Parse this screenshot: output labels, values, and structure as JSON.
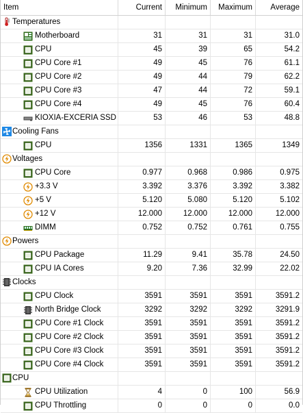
{
  "columns": [
    "Item",
    "Current",
    "Minimum",
    "Maximum",
    "Average"
  ],
  "groups": [
    {
      "label": "Temperatures",
      "icon": "thermometer-icon",
      "items": [
        {
          "label": "Motherboard",
          "icon": "motherboard-icon",
          "current": "31",
          "minimum": "31",
          "maximum": "31",
          "average": "31.0"
        },
        {
          "label": "CPU",
          "icon": "cpu-chip-icon",
          "current": "45",
          "minimum": "39",
          "maximum": "65",
          "average": "54.2"
        },
        {
          "label": "CPU Core #1",
          "icon": "cpu-chip-icon",
          "current": "49",
          "minimum": "45",
          "maximum": "76",
          "average": "61.1"
        },
        {
          "label": "CPU Core #2",
          "icon": "cpu-chip-icon",
          "current": "49",
          "minimum": "44",
          "maximum": "79",
          "average": "62.2"
        },
        {
          "label": "CPU Core #3",
          "icon": "cpu-chip-icon",
          "current": "47",
          "minimum": "44",
          "maximum": "72",
          "average": "59.1"
        },
        {
          "label": "CPU Core #4",
          "icon": "cpu-chip-icon",
          "current": "49",
          "minimum": "45",
          "maximum": "76",
          "average": "60.4"
        },
        {
          "label": "KIOXIA-EXCERIA SSD",
          "icon": "ssd-icon",
          "current": "53",
          "minimum": "46",
          "maximum": "53",
          "average": "48.8"
        }
      ]
    },
    {
      "label": "Cooling Fans",
      "icon": "fan-icon",
      "items": [
        {
          "label": "CPU",
          "icon": "cpu-chip-icon",
          "current": "1356",
          "minimum": "1331",
          "maximum": "1365",
          "average": "1349"
        }
      ]
    },
    {
      "label": "Voltages",
      "icon": "lightning-icon",
      "items": [
        {
          "label": "CPU Core",
          "icon": "cpu-chip-icon",
          "current": "0.977",
          "minimum": "0.968",
          "maximum": "0.986",
          "average": "0.975"
        },
        {
          "label": "+3.3 V",
          "icon": "lightning-icon",
          "current": "3.392",
          "minimum": "3.376",
          "maximum": "3.392",
          "average": "3.382"
        },
        {
          "label": "+5 V",
          "icon": "lightning-icon",
          "current": "5.120",
          "minimum": "5.080",
          "maximum": "5.120",
          "average": "5.102"
        },
        {
          "label": "+12 V",
          "icon": "lightning-icon",
          "current": "12.000",
          "minimum": "12.000",
          "maximum": "12.000",
          "average": "12.000"
        },
        {
          "label": "DIMM",
          "icon": "memory-icon",
          "current": "0.752",
          "minimum": "0.752",
          "maximum": "0.761",
          "average": "0.755"
        }
      ]
    },
    {
      "label": "Powers",
      "icon": "lightning-icon",
      "items": [
        {
          "label": "CPU Package",
          "icon": "cpu-chip-icon",
          "current": "11.29",
          "minimum": "9.41",
          "maximum": "35.78",
          "average": "24.50"
        },
        {
          "label": "CPU IA Cores",
          "icon": "cpu-chip-icon",
          "current": "9.20",
          "minimum": "7.36",
          "maximum": "32.99",
          "average": "22.02"
        }
      ]
    },
    {
      "label": "Clocks",
      "icon": "clock-chip-icon",
      "items": [
        {
          "label": "CPU Clock",
          "icon": "cpu-chip-icon",
          "current": "3591",
          "minimum": "3591",
          "maximum": "3591",
          "average": "3591.2"
        },
        {
          "label": "North Bridge Clock",
          "icon": "clock-chip-icon",
          "current": "3292",
          "minimum": "3292",
          "maximum": "3292",
          "average": "3291.9"
        },
        {
          "label": "CPU Core #1 Clock",
          "icon": "cpu-chip-icon",
          "current": "3591",
          "minimum": "3591",
          "maximum": "3591",
          "average": "3591.2"
        },
        {
          "label": "CPU Core #2 Clock",
          "icon": "cpu-chip-icon",
          "current": "3591",
          "minimum": "3591",
          "maximum": "3591",
          "average": "3591.2"
        },
        {
          "label": "CPU Core #3 Clock",
          "icon": "cpu-chip-icon",
          "current": "3591",
          "minimum": "3591",
          "maximum": "3591",
          "average": "3591.2"
        },
        {
          "label": "CPU Core #4 Clock",
          "icon": "cpu-chip-icon",
          "current": "3591",
          "minimum": "3591",
          "maximum": "3591",
          "average": "3591.2"
        }
      ]
    },
    {
      "label": "CPU",
      "icon": "cpu-chip-icon",
      "items": [
        {
          "label": "CPU Utilization",
          "icon": "hourglass-icon",
          "current": "4",
          "minimum": "0",
          "maximum": "100",
          "average": "56.9"
        },
        {
          "label": "CPU Throttling",
          "icon": "cpu-chip-icon",
          "current": "0",
          "minimum": "0",
          "maximum": "0",
          "average": "0.0"
        }
      ]
    }
  ]
}
